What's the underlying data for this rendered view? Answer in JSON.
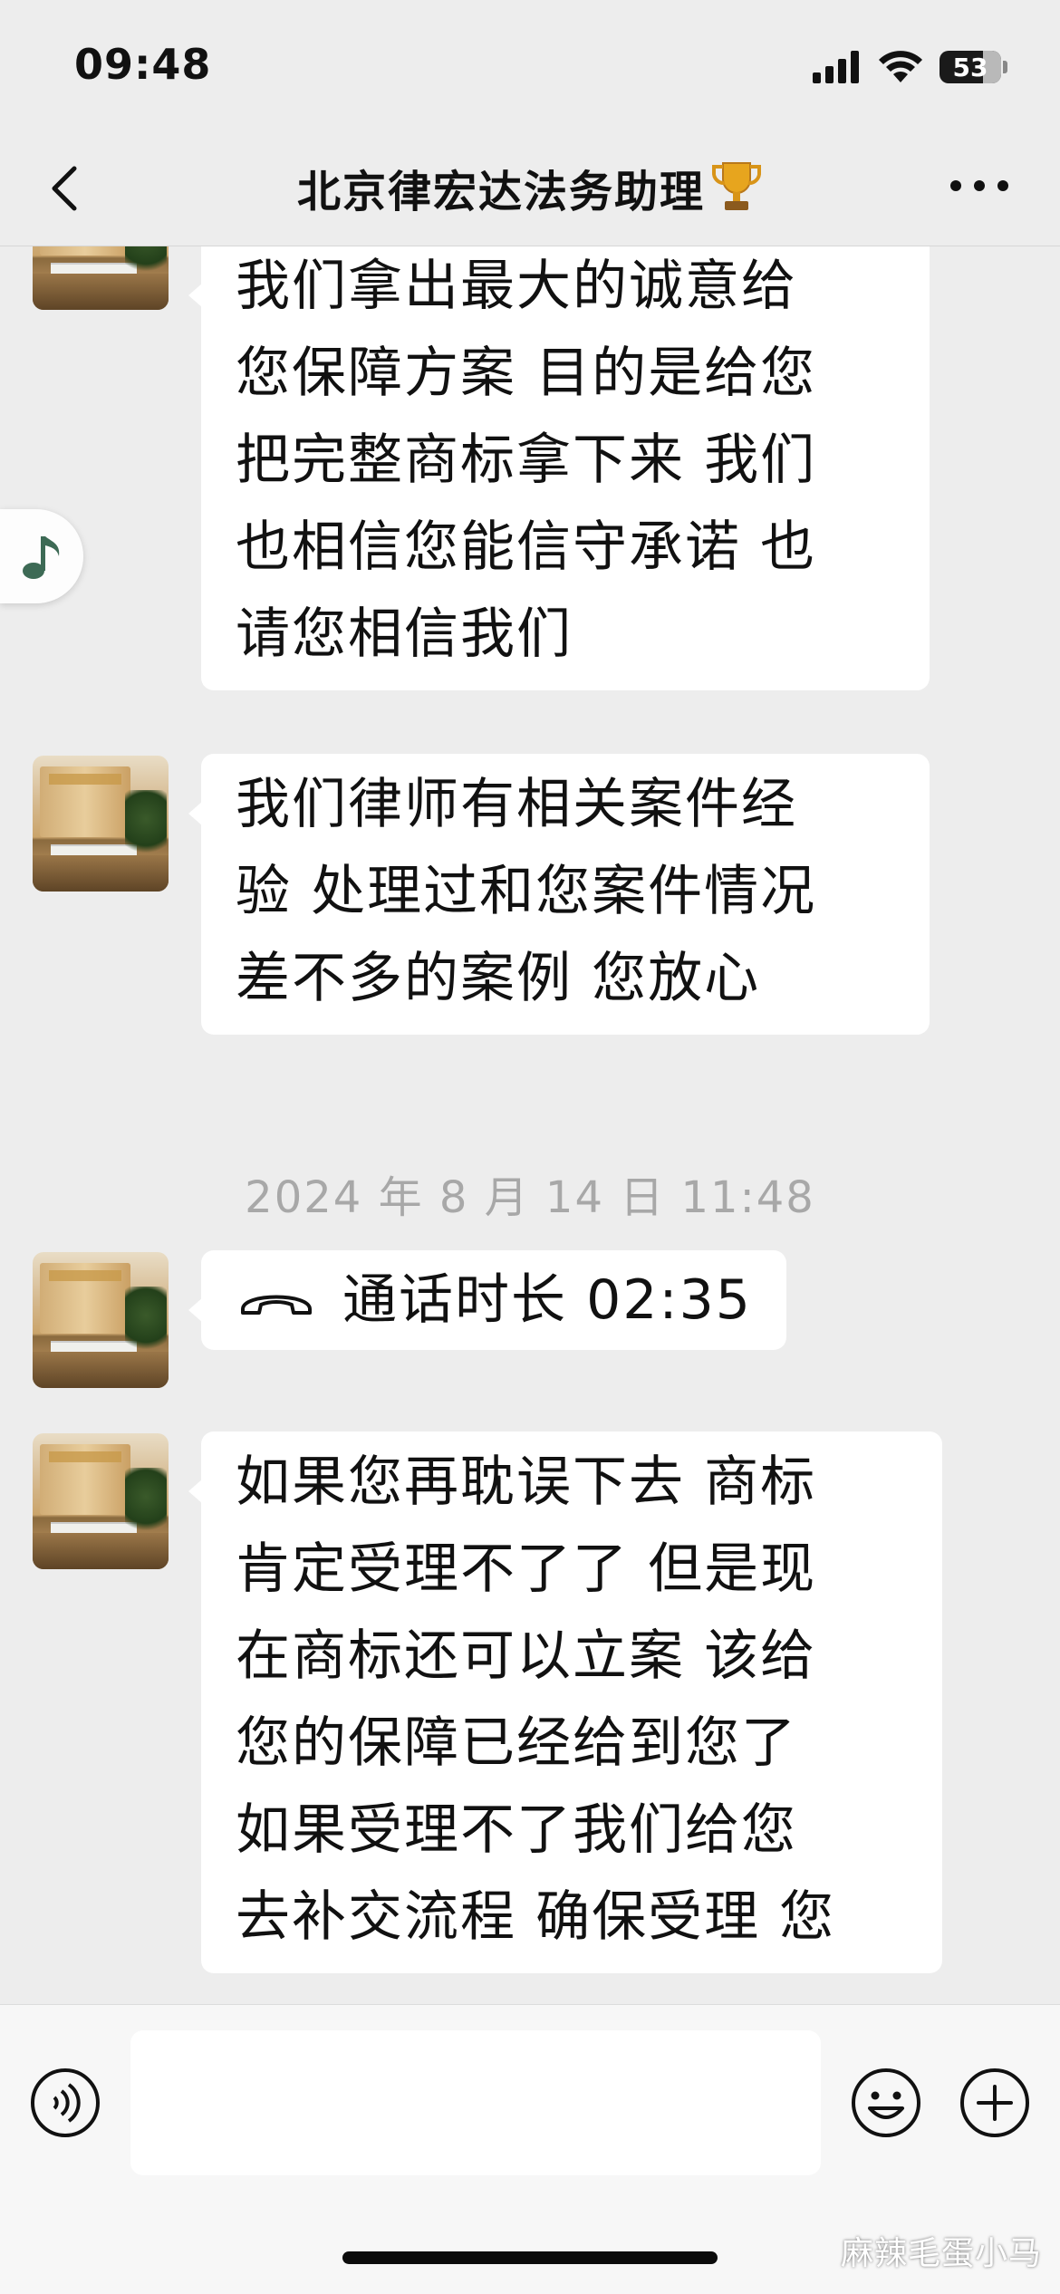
{
  "status_bar": {
    "time": "09:48",
    "battery_level": "53"
  },
  "header": {
    "title": "北京律宏达法务助理"
  },
  "messages": [
    {
      "type": "text",
      "lines": [
        "我们拿出最大的诚意给",
        "您保障方案 目的是给您",
        "把完整商标拿下来 我们",
        "也相信您能信守承诺 也",
        "请您相信我们"
      ]
    },
    {
      "type": "text",
      "lines": [
        "我们律师有相关案件经",
        "验 处理过和您案件情况",
        "差不多的案例 您放心"
      ]
    },
    {
      "type": "call",
      "label": "通话时长 02:35"
    },
    {
      "type": "text",
      "lines": [
        "如果您再耽误下去 商标",
        "肯定受理不了了 但是现",
        "在商标还可以立案  该给",
        "您的保障已经给到您了",
        "如果受理不了我们给您",
        "去补交流程 确保受理 您"
      ]
    }
  ],
  "timestamp": "2024 年 8 月 14 日 11:48",
  "input": {
    "value": ""
  },
  "watermark": "麻辣毛蛋小马",
  "icons": {
    "back": "chevron-left-icon",
    "title_badge": "trophy-icon",
    "more": "more-dots-icon",
    "call": "phone-hangup-icon",
    "voice": "voice-icon",
    "emoji": "smiley-icon",
    "plus": "plus-icon",
    "music": "music-note-icon"
  },
  "colors": {
    "background": "#ededed",
    "bubble": "#ffffff",
    "timestamp": "#a8a8a8"
  }
}
